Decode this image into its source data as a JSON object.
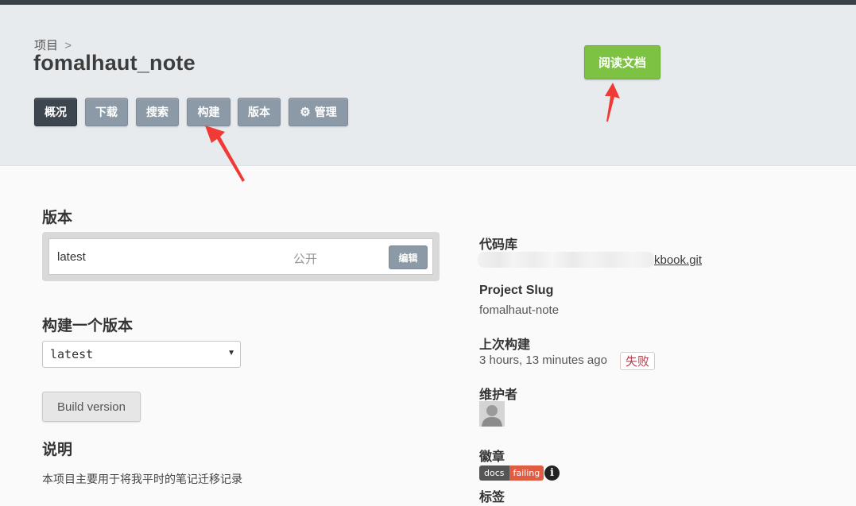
{
  "header": {
    "breadcrumb": "项目",
    "breadcrumb_sep": ">",
    "project_title": "fomalhaut_note",
    "tabs": [
      {
        "label": "概况",
        "active": true
      },
      {
        "label": "下载"
      },
      {
        "label": "搜索"
      },
      {
        "label": "构建"
      },
      {
        "label": "版本"
      },
      {
        "label": "管理",
        "icon": "gear-icon"
      }
    ],
    "read_docs_label": "阅读文档"
  },
  "versions": {
    "heading": "版本",
    "items": [
      {
        "name": "latest",
        "privacy": "公开",
        "edit_label": "编辑"
      }
    ]
  },
  "build": {
    "heading": "构建一个版本",
    "selected_version": "latest",
    "button_label": "Build version"
  },
  "description": {
    "heading": "说明",
    "text": "本项目主要用于将我平时的笔记迁移记录"
  },
  "sidebar": {
    "repo_label": "代码库",
    "repo_link_visible": "kbook.git",
    "slug_label": "Project Slug",
    "slug_value": "fomalhaut-note",
    "last_build_label": "上次构建",
    "last_build_time": "3 hours, 13 minutes ago",
    "last_build_status": "失败",
    "maintainers_label": "维护者",
    "badge_label": "徽章",
    "badge_left": "docs",
    "badge_right": "failing",
    "tags_label": "标签"
  },
  "colors": {
    "accent_green": "#7dc242",
    "tab_gray": "#8b9aa6",
    "tab_active": "#3d464f",
    "annotation_red": "#f03a36"
  }
}
